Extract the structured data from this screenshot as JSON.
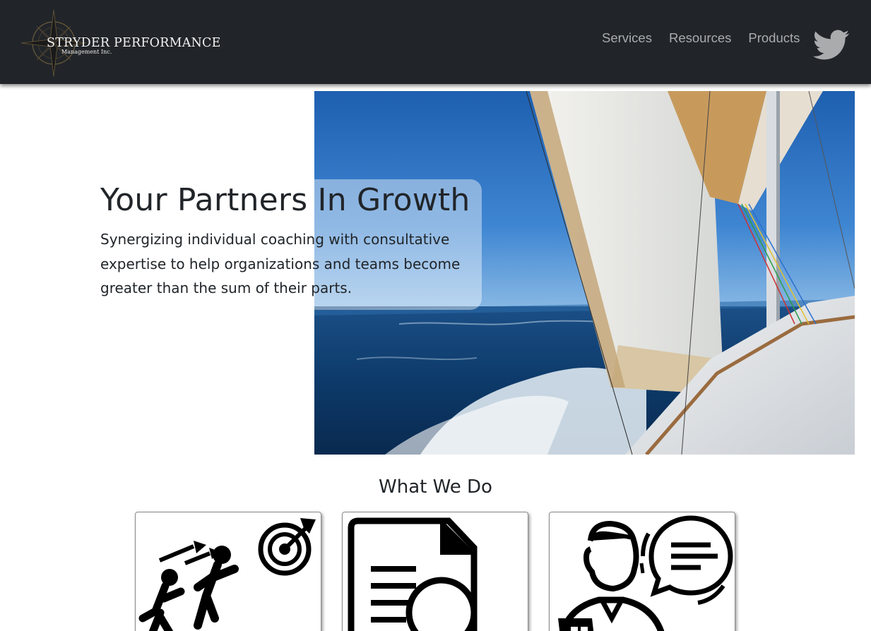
{
  "navbar": {
    "brand_title": "STRYDER PERFORMANCE",
    "brand_subtitle": "Management Inc.",
    "links": [
      "Services",
      "Resources",
      "Products"
    ],
    "social_icon": "twitter-icon"
  },
  "hero": {
    "title": "Your Partners In Growth",
    "text": "Synergizing individual coaching with consultative expertise to help organizations and teams become greater than the sum of their parts.",
    "image": "sailboat-photo"
  },
  "what_we_do": {
    "title": "What We Do",
    "cards": [
      {
        "icon": "team-target-icon"
      },
      {
        "icon": "document-search-icon"
      },
      {
        "icon": "consultant-chat-icon"
      }
    ]
  },
  "colors": {
    "navbar_bg": "#212529",
    "nav_link": "#a9abad",
    "text": "#212529",
    "sky": "#2a6fc0",
    "sea": "#0e3f73"
  }
}
